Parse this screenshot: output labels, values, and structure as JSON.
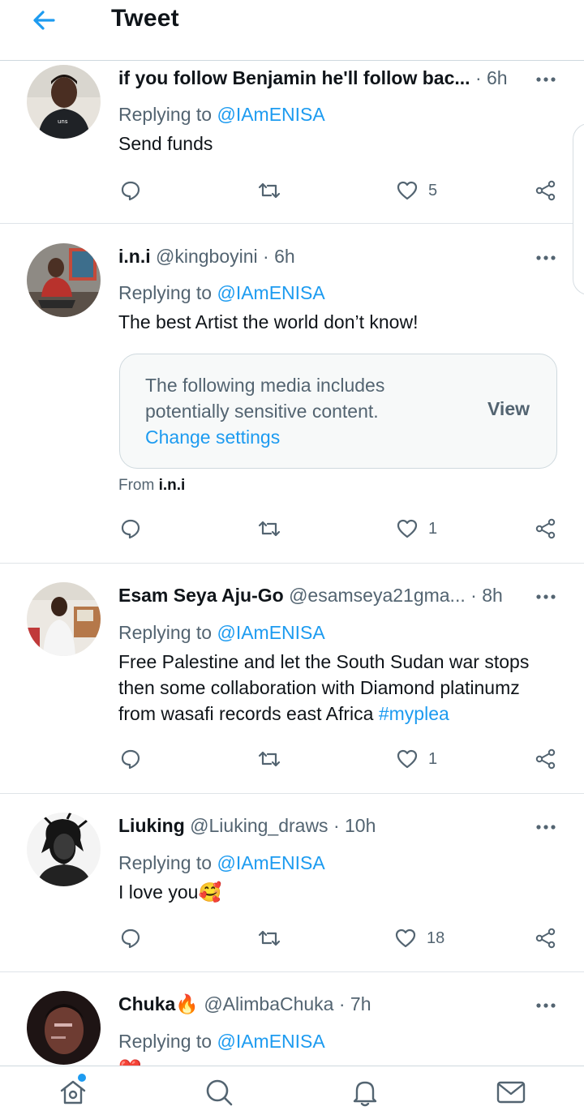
{
  "header": {
    "title": "Tweet",
    "back_icon": "arrow-left-icon"
  },
  "colors": {
    "accent": "#1d9bf0",
    "secondary_text": "#536471",
    "primary_text": "#0f1419",
    "divider": "#cfd9de"
  },
  "tweets": [
    {
      "name": "if you follow Benjamin he'll follow bac...",
      "handle": "",
      "dot": "·",
      "time": "6h",
      "replying_prefix": "Replying to",
      "replying_to": "@IAmENISA",
      "text": "Send funds",
      "like_count": "5"
    },
    {
      "name": "i.n.i",
      "handle": "@kingboyini",
      "dot": "·",
      "time": "6h",
      "replying_prefix": "Replying to",
      "replying_to": "@IAmENISA",
      "text": "The best Artist the world don’t know!",
      "sensitive_notice": "The following media includes potentially sensitive content.",
      "change_settings": "Change settings",
      "view_label": "View",
      "from_prefix": "From",
      "from_name": "i.n.i",
      "like_count": "1"
    },
    {
      "name": "Esam Seya Aju-Go",
      "handle": "@esamseya21gma...",
      "dot": "·",
      "time": "8h",
      "replying_prefix": "Replying to",
      "replying_to": "@IAmENISA",
      "text": "Free Palestine and let the South Sudan war stops then some collaboration with Diamond platinumz from wasafi records east Africa",
      "hashtag": "#myplea",
      "like_count": "1"
    },
    {
      "name": "Liuking",
      "handle": "@Liuking_draws",
      "dot": "·",
      "time": "10h",
      "replying_prefix": "Replying to",
      "replying_to": "@IAmENISA",
      "text": "I love you🥰",
      "like_count": "18"
    },
    {
      "name": "Chuka🔥",
      "handle": "@AlimbaChuka",
      "dot": "·",
      "time": "7h",
      "replying_prefix": "Replying to",
      "replying_to": "@IAmENISA",
      "text": "❤️"
    }
  ],
  "bottom_nav": {
    "items": [
      "home-icon",
      "search-icon",
      "notifications-bell-icon",
      "messages-envelope-icon"
    ],
    "home_has_notification_dot": true
  }
}
